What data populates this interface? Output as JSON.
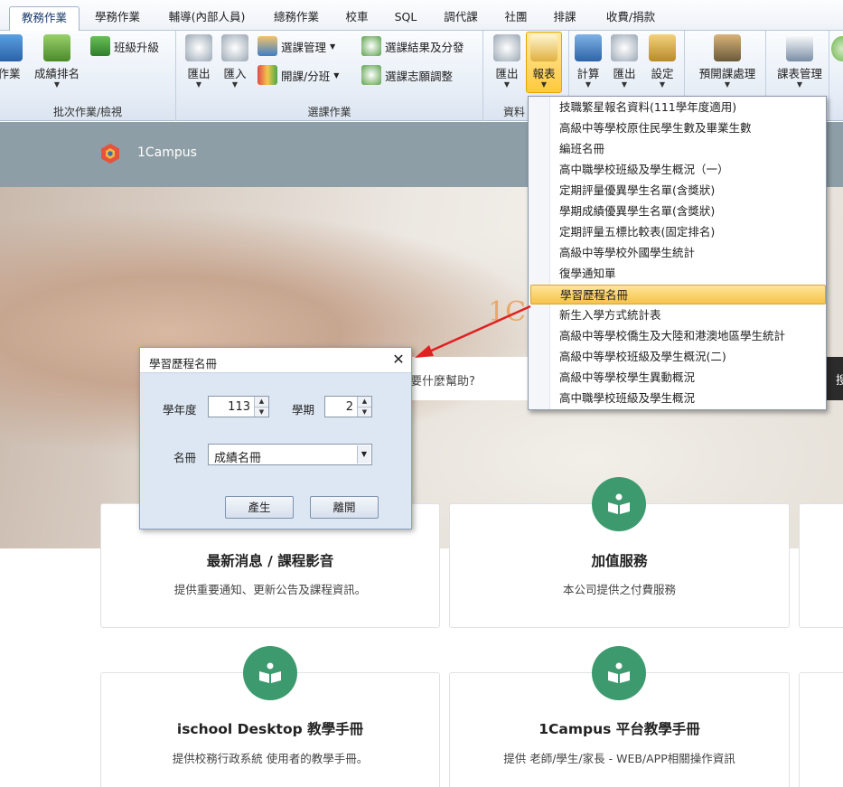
{
  "ribbon": {
    "tabs": [
      "教務作業",
      "學務作業",
      "輔導(內部人員)",
      "總務作業",
      "校車",
      "SQL",
      "調代課",
      "社團",
      "排課",
      "收費/捐款"
    ],
    "active_tab": "教務作業",
    "groups": {
      "batch": {
        "label": "批次作業/檢視",
        "btn_partial": "作業",
        "rank": "成績排名",
        "promote": "班級升級"
      },
      "course": {
        "label": "選課作業",
        "export": "匯出",
        "import": "匯入",
        "course_mgmt": "選課管理",
        "open_class": "開課/分班",
        "result": "選課結果及分發",
        "wish_adjust": "選課志願調整"
      },
      "data": {
        "label": "資料",
        "export": "匯出",
        "report": "報表"
      },
      "calc": {
        "compute": "計算",
        "export": "匯出",
        "settings": "設定"
      },
      "preopen": {
        "label": "預開課處理"
      },
      "schedule": {
        "label": "課表管理"
      }
    }
  },
  "site": {
    "logo": "1Campus",
    "hero_brand": "1C",
    "search_placeholder": "要什麼幫助?",
    "search_button": "搜"
  },
  "cards": [
    {
      "title": "最新消息 / 課程影音",
      "desc": "提供重要通知、更新公告及課程資訊。"
    },
    {
      "title": "加值服務",
      "desc": "本公司提供之付費服務"
    },
    {
      "title": "ischool Desktop 教學手冊",
      "desc": "提供校務行政系統 使用者的教學手冊。"
    },
    {
      "title": "1Campus 平台教學手冊",
      "desc": "提供 老師/學生/家長 - WEB/APP相關操作資訊"
    }
  ],
  "report_menu": {
    "items": [
      "技職繁星報名資料(111學年度適用)",
      "高級中等學校原住民學生數及畢業生數",
      "編班名冊",
      "高中職學校班級及學生概況（一）",
      "定期評量優異學生名單(含獎狀)",
      "學期成績優異學生名單(含獎狀)",
      "定期評量五標比較表(固定排名)",
      "高級中等學校外國學生統計",
      "復學通知單",
      "學習歷程名冊",
      "新生入學方式統計表",
      "高級中等學校僑生及大陸和港澳地區學生統計",
      "高級中等學校班級及學生概況(二)",
      "高級中等學校學生異動概況",
      "高中職學校班級及學生概況"
    ],
    "selected": "學習歷程名冊"
  },
  "dialog": {
    "title": "學習歷程名冊",
    "year_label": "學年度",
    "year_value": "113",
    "semester_label": "學期",
    "semester_value": "2",
    "roster_label": "名冊",
    "roster_value": "成績名冊",
    "generate": "產生",
    "leave": "離開"
  },
  "colors": {
    "accent_green": "#3d9a6e",
    "highlight": "#f6c24a",
    "annotation_arrow": "#e02020"
  }
}
